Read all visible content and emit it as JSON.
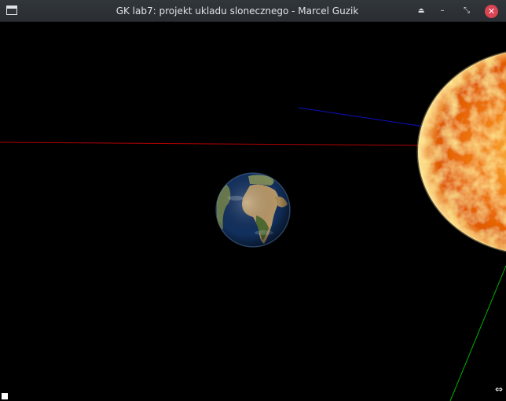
{
  "window": {
    "title": "GK lab7: projekt ukladu slonecznego - Marcel Guzik",
    "icons": {
      "app": "window-icon",
      "keep_above": "keep-above-icon",
      "minimize": "minimize-icon",
      "maximize": "restore-icon",
      "close": "close-icon"
    },
    "glyphs": {
      "keep_above": "⏏",
      "minimize": "–",
      "maximize": "⤡",
      "close": "✕"
    }
  },
  "scene": {
    "background": "#000000",
    "objects": [
      "sun",
      "earth"
    ],
    "axes": {
      "x_color": "#cc0000",
      "y_color": "#00cc00",
      "z_color": "#0000cc"
    },
    "sun_colors": [
      "#fff2a0",
      "#ffb000",
      "#f06a00",
      "#d04000"
    ],
    "earth_colors": [
      "#c9b486",
      "#5c7a3e",
      "#2a5c9a",
      "#0c2850"
    ]
  },
  "cursor": {
    "icon": "resize-cursor-icon",
    "glyph": "⇔"
  }
}
